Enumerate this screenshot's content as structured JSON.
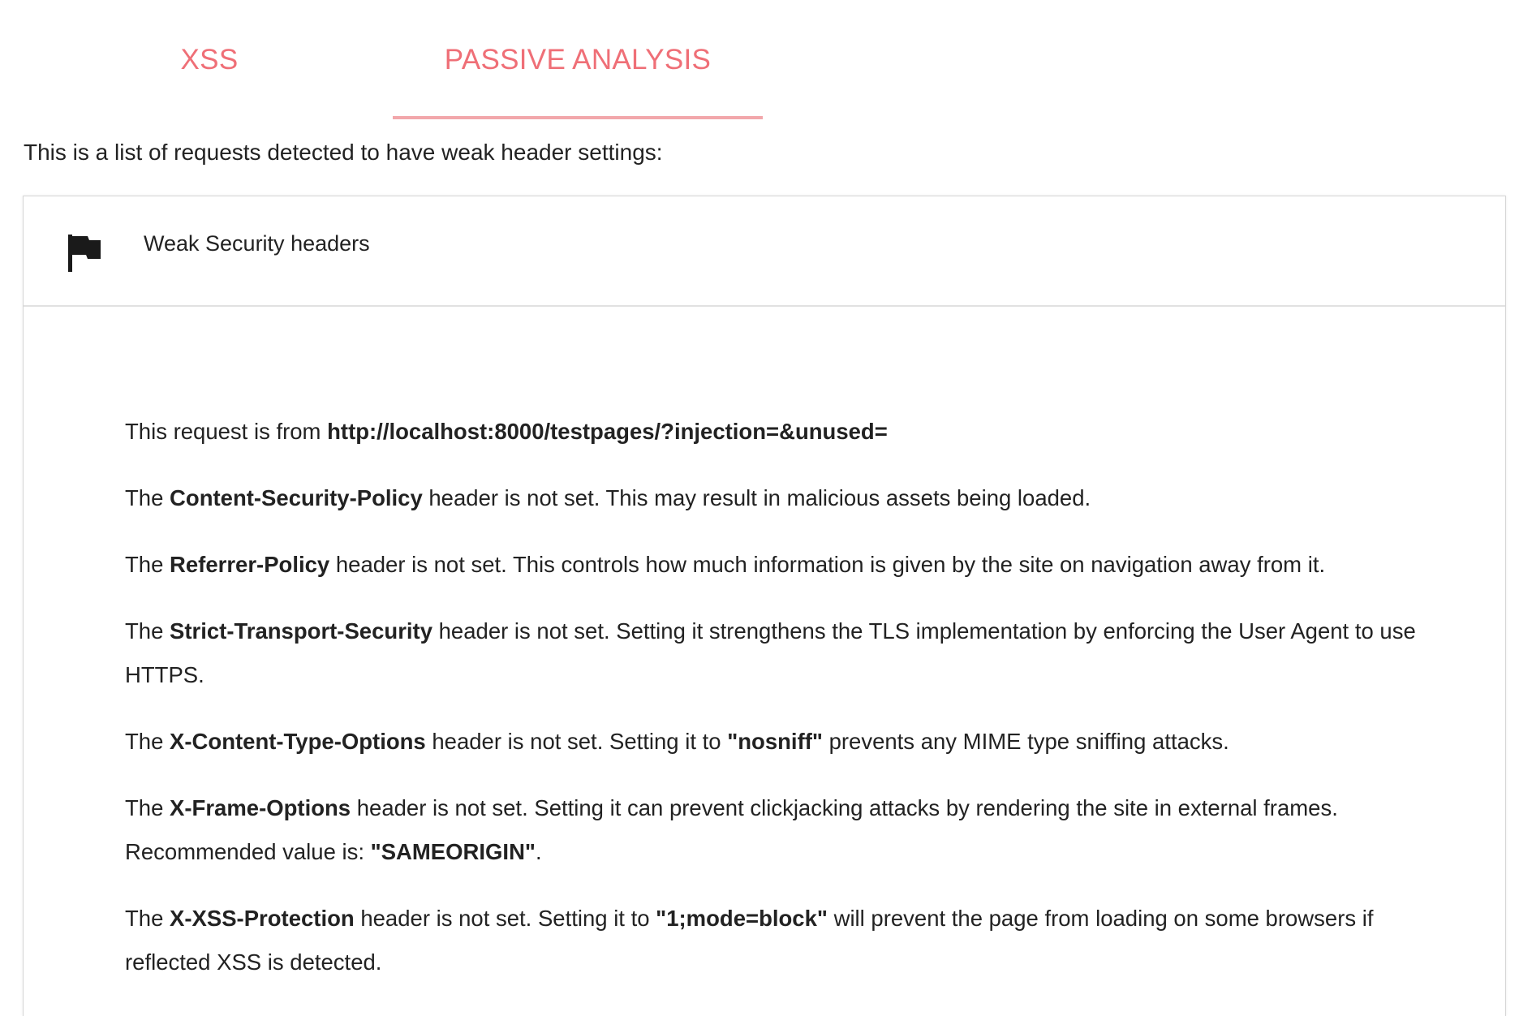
{
  "colors": {
    "tab_accent": "#ef6f77",
    "tab_indicator": "#f2a7ab",
    "text": "#222222"
  },
  "tabs": [
    {
      "label": "XSS",
      "active": false
    },
    {
      "label": "PASSIVE ANALYSIS",
      "active": true
    }
  ],
  "intro_text": "This is a list of requests detected to have weak header settings:",
  "panel": {
    "icon": "flag-icon",
    "title": "Weak Security headers",
    "request": {
      "prefix": "This request is from ",
      "url": "http://localhost:8000/testpages/?injection=&unused="
    },
    "findings": [
      {
        "pre": "The ",
        "header": "Content-Security-Policy",
        "text": " header is not set. This may result in malicious assets being loaded."
      },
      {
        "pre": "The ",
        "header": "Referrer-Policy",
        "text": " header is not set. This controls how much information is given by the site on navigation away from it."
      },
      {
        "pre": "The ",
        "header": "Strict-Transport-Security",
        "text": " header is not set. Setting it strengthens the TLS implementation by enforcing the User Agent to use HTTPS."
      },
      {
        "pre": "The ",
        "header": "X-Content-Type-Options",
        "text": " header is not set. Setting it to ",
        "value": "\"nosniff\"",
        "post": " prevents any MIME type sniffing attacks."
      },
      {
        "pre": "The ",
        "header": "X-Frame-Options",
        "text": " header is not set. Setting it can prevent clickjacking attacks by rendering the site in external frames. Recommended value is: ",
        "value": "\"SAMEORIGIN\"",
        "post": "."
      },
      {
        "pre": "The ",
        "header": "X-XSS-Protection",
        "text": " header is not set. Setting it to ",
        "value": "\"1;mode=block\"",
        "post": " will prevent the page from loading on some browsers if reflected XSS is detected."
      }
    ]
  }
}
